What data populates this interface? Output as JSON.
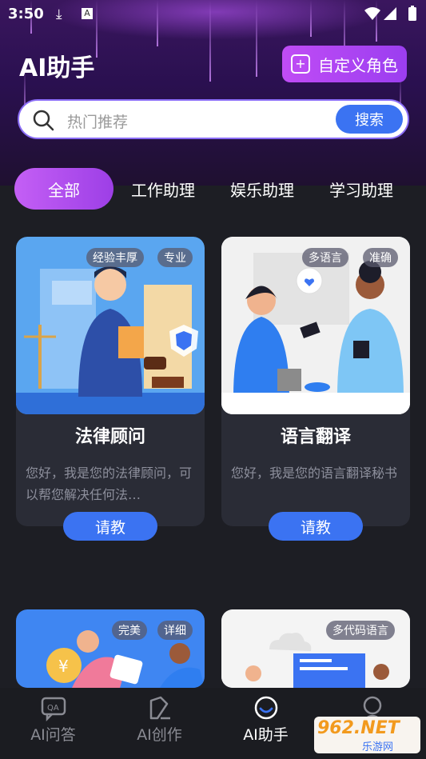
{
  "status": {
    "time": "3:50"
  },
  "header": {
    "title": "AI助手",
    "custom_role_label": "自定义角色"
  },
  "search": {
    "placeholder": "热门推荐",
    "button_label": "搜索"
  },
  "tabs": [
    {
      "label": "全部",
      "active": true
    },
    {
      "label": "工作助理",
      "active": false
    },
    {
      "label": "娱乐助理",
      "active": false
    },
    {
      "label": "学习助理",
      "active": false
    }
  ],
  "cards": [
    {
      "title": "法律顾问",
      "tags": [
        "经验丰厚",
        "专业"
      ],
      "desc": "您好，我是您的法律顾问，可以帮您解决任何法…",
      "button": "请教"
    },
    {
      "title": "语言翻译",
      "tags": [
        "多语言",
        "准确"
      ],
      "desc": "您好，我是您的语言翻译秘书",
      "button": "请教"
    },
    {
      "title": "",
      "tags": [
        "完美",
        "详细"
      ],
      "desc": "",
      "button": ""
    },
    {
      "title": "",
      "tags": [
        "多代码语言"
      ],
      "desc": "",
      "button": ""
    }
  ],
  "bottom_nav": [
    {
      "label": "AI问答",
      "icon": "qa-chat-icon",
      "active": false
    },
    {
      "label": "AI创作",
      "icon": "pen-write-icon",
      "active": false
    },
    {
      "label": "AI助手",
      "icon": "assistant-icon",
      "active": true
    },
    {
      "label": "",
      "icon": "user-icon",
      "active": false
    }
  ],
  "watermark": {
    "text_top": "962.NET",
    "text_bottom": "乐游网"
  },
  "colors": {
    "accent_blue": "#3b73f2",
    "accent_purple": "#b04ef2",
    "background": "#1d1e24",
    "card": "#2a2c36"
  }
}
